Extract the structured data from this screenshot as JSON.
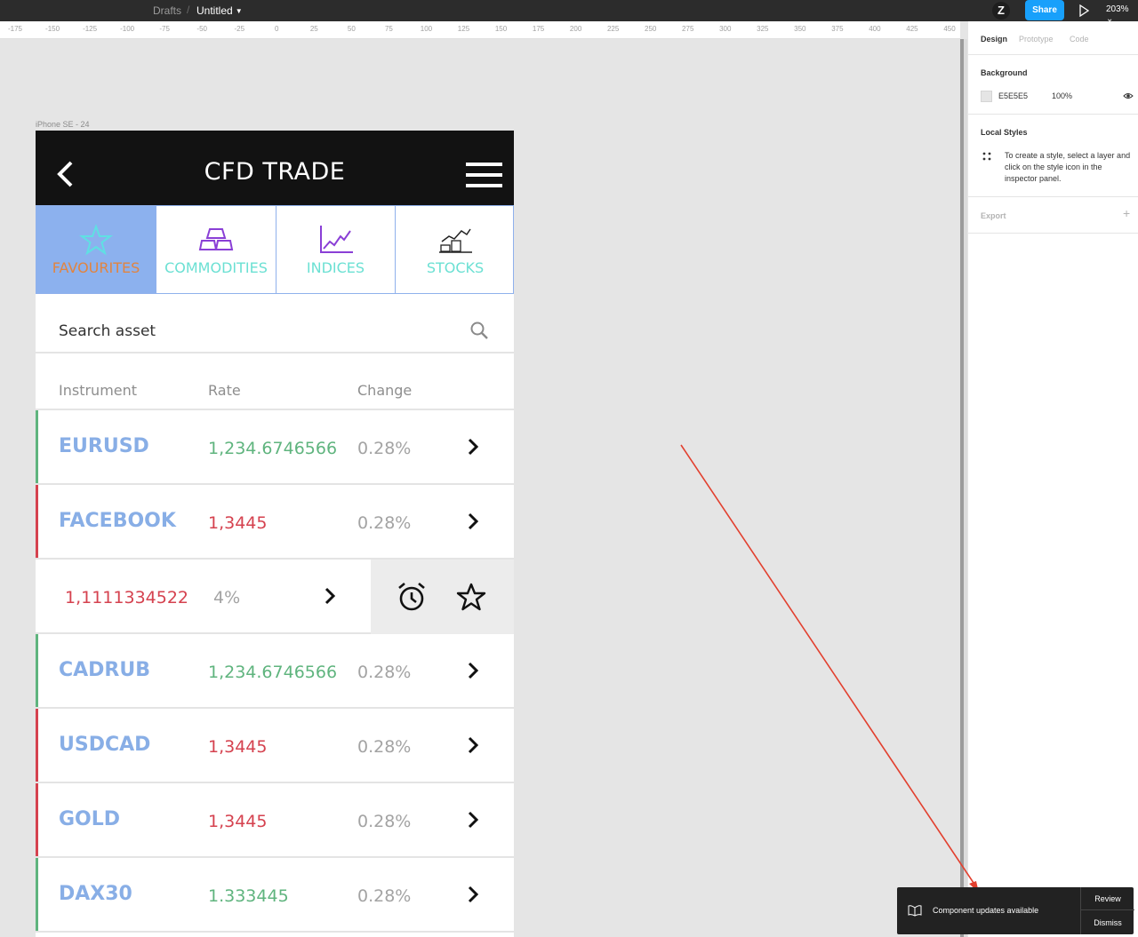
{
  "topbar": {
    "breadcrumb_root": "Drafts",
    "separator": "/",
    "file_title": "Untitled",
    "avatar_initial": "Z",
    "share_label": "Share",
    "zoom": "203%"
  },
  "ruler": {
    "ticks": [
      "-175",
      "-150",
      "-125",
      "-100",
      "-75",
      "-50",
      "-25",
      "0",
      "25",
      "50",
      "75",
      "100",
      "125",
      "150",
      "175",
      "200",
      "225",
      "250",
      "275",
      "300",
      "325",
      "350",
      "375",
      "400",
      "425",
      "450"
    ]
  },
  "panel": {
    "tabs": [
      "Design",
      "Prototype",
      "Code"
    ],
    "background_title": "Background",
    "background_hex": "E5E5E5",
    "background_opacity": "100%",
    "local_styles_title": "Local Styles",
    "local_styles_hint": "To create a style, select a layer and click on the style icon in the inspector panel.",
    "export_title": "Export",
    "export_add": "+"
  },
  "frame": {
    "label": "iPhone SE - 24"
  },
  "app": {
    "title": "CFD TRADE",
    "categories": [
      {
        "label": "FAVOURITES",
        "icon": "star-icon"
      },
      {
        "label": "COMMODITIES",
        "icon": "gold-bars-icon"
      },
      {
        "label": "INDICES",
        "icon": "line-chart-icon"
      },
      {
        "label": "STOCKS",
        "icon": "stocks-icon"
      }
    ],
    "search_placeholder": "Search asset",
    "columns": [
      "Instrument",
      "Rate",
      "Change"
    ],
    "rows": [
      {
        "symbol": "EURUSD",
        "rate": "1,234.6746566",
        "change": "0.28%",
        "trend": "up"
      },
      {
        "symbol": "FACEBOOK",
        "rate": "1,3445",
        "change": "0.28%",
        "trend": "down"
      },
      {
        "symbol": "",
        "rate": "1,1111334522",
        "change": "4%",
        "trend": "down"
      },
      {
        "symbol": "CADRUB",
        "rate": "1,234.6746566",
        "change": "0.28%",
        "trend": "up"
      },
      {
        "symbol": "USDCAD",
        "rate": "1,3445",
        "change": "0.28%",
        "trend": "down"
      },
      {
        "symbol": "GOLD",
        "rate": "1,3445",
        "change": "0.28%",
        "trend": "down"
      },
      {
        "symbol": "DAX30",
        "rate": "1.333445",
        "change": "0.28%",
        "trend": "up"
      }
    ],
    "colors": {
      "up": "#5fb47e",
      "down": "#d5424f",
      "symbol": "#88aee6",
      "active_tab": "#8cb1ee"
    }
  },
  "toast": {
    "message": "Component updates available",
    "review_label": "Review",
    "dismiss_label": "Dismiss"
  }
}
